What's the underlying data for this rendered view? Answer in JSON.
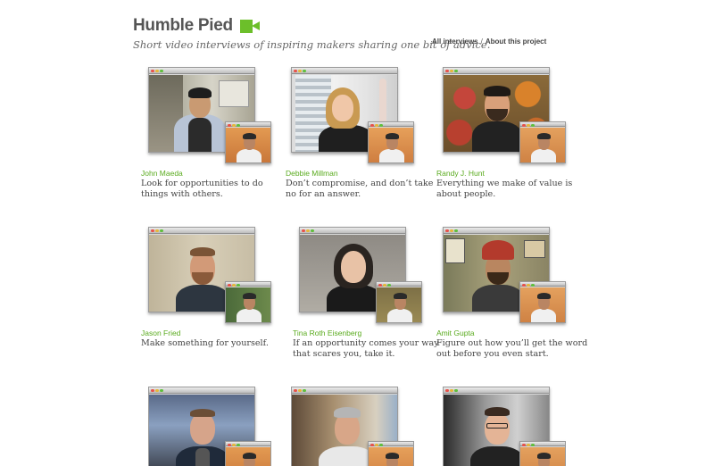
{
  "site": {
    "title": "Humble Pied",
    "tagline": "Short video interviews of inspiring makers sharing one bit of advice.",
    "brand_icon": "video-camera-icon",
    "accent_color": "#6cbf2a"
  },
  "nav": {
    "all_interviews": "All interviews",
    "separator": "/",
    "about": "About this project"
  },
  "interviews": [
    {
      "name": "John Maeda",
      "quote_line1": "Look for opportunities to do",
      "quote_line2": "things with others."
    },
    {
      "name": "Debbie Millman",
      "quote_line1": "Don’t compromise, and don’t take",
      "quote_line2": "no for an answer."
    },
    {
      "name": "Randy J. Hunt",
      "quote_line1": "Everything we make of value is",
      "quote_line2": "about people."
    },
    {
      "name": "Jason Fried",
      "quote_line1": "Make something for yourself.",
      "quote_line2": ""
    },
    {
      "name": "Tina Roth Eisenberg",
      "quote_line1": "If an opportunity comes your way",
      "quote_line2": "that scares you, take it."
    },
    {
      "name": "Amit Gupta",
      "quote_line1": "Figure out how you’ll get the word",
      "quote_line2": "out before you even start."
    },
    {
      "name": "",
      "quote_line1": "",
      "quote_line2": ""
    },
    {
      "name": "",
      "quote_line1": "",
      "quote_line2": ""
    },
    {
      "name": "",
      "quote_line1": "",
      "quote_line2": ""
    }
  ]
}
